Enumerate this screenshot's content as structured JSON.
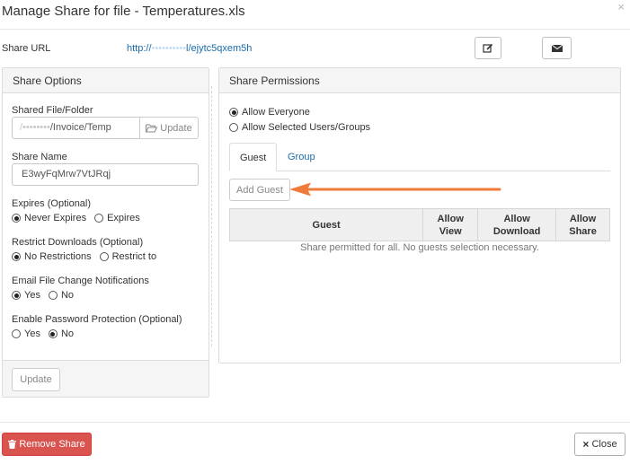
{
  "dialog": {
    "title": "Manage Share for file - Temperatures.xls",
    "close_glyph": "×"
  },
  "share_url": {
    "label": "Share URL",
    "prefix": "http://",
    "blurred": "••••••••••",
    "suffix": "l/ejytc5qxem5h"
  },
  "share_options": {
    "title": "Share Options",
    "shared_file_label": "Shared File/Folder",
    "shared_file_blurred": "/••••••••",
    "shared_file_value": "/Invoice/Temp",
    "folder_update_label": "Update",
    "share_name_label": "Share Name",
    "share_name_value": "E3wyFqMrw7VtJRqj",
    "expires": {
      "label": "Expires (Optional)",
      "options": [
        "Never Expires",
        "Expires"
      ],
      "selected": "Never Expires"
    },
    "restrict_downloads": {
      "label": "Restrict Downloads (Optional)",
      "options": [
        "No Restrictions",
        "Restrict to"
      ],
      "selected": "No Restrictions"
    },
    "email_notifications": {
      "label": "Email File Change Notifications",
      "options": [
        "Yes",
        "No"
      ],
      "selected": "Yes"
    },
    "password_protection": {
      "label": "Enable Password Protection (Optional)",
      "options": [
        "Yes",
        "No"
      ],
      "selected": "No"
    },
    "update_button": "Update"
  },
  "share_permissions": {
    "title": "Share Permissions",
    "options": [
      "Allow Everyone",
      "Allow Selected Users/Groups"
    ],
    "selected": "Allow Everyone",
    "tabs": [
      {
        "label": "Guest",
        "active": true
      },
      {
        "label": "Group",
        "active": false
      }
    ],
    "add_guest_button": "Add Guest",
    "table_headers": {
      "guest": "Guest",
      "allow_view": "Allow View",
      "allow_download": "Allow Download",
      "allow_share": "Allow Share"
    },
    "empty_message": "Share permitted for all. No guests selection necessary."
  },
  "annotation": {
    "arrow_color": "#f07a3a"
  },
  "footer": {
    "remove_share_label": "Remove Share",
    "close_label": "Close"
  }
}
